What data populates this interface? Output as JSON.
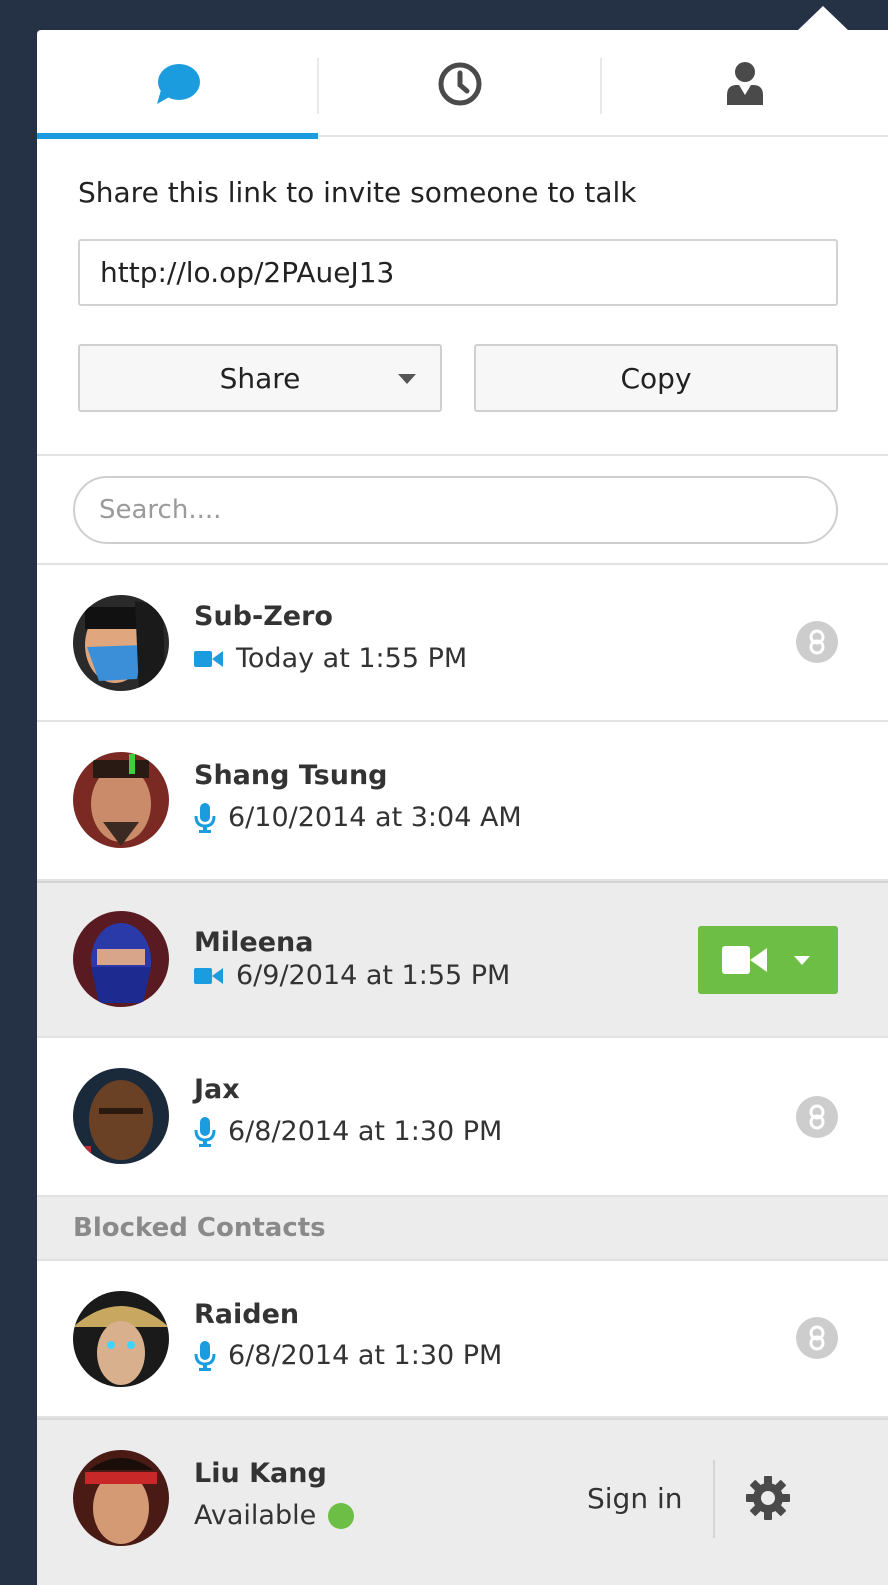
{
  "tabs": [
    {
      "name": "chat",
      "icon": "chat-bubble-icon",
      "active": true
    },
    {
      "name": "history",
      "icon": "clock-icon",
      "active": false
    },
    {
      "name": "contacts",
      "icon": "person-icon",
      "active": false
    }
  ],
  "invite": {
    "label": "Share this link to invite someone to talk",
    "link": "http://lo.op/2PAueJ13",
    "share_label": "Share",
    "copy_label": "Copy"
  },
  "search": {
    "placeholder": "Search...."
  },
  "contacts": [
    {
      "name": "Sub-Zero",
      "type": "video",
      "time": "Today at 1:55 PM"
    },
    {
      "name": "Shang Tsung",
      "type": "audio",
      "time": "6/10/2014 at 3:04 AM"
    },
    {
      "name": "Mileena",
      "type": "video",
      "time": "6/9/2014 at 1:55 PM"
    },
    {
      "name": "Jax",
      "type": "audio",
      "time": "6/8/2014 at 1:30 PM"
    }
  ],
  "blocked": {
    "header": "Blocked Contacts",
    "contacts": [
      {
        "name": "Raiden",
        "type": "audio",
        "time": "6/8/2014 at 1:30 PM"
      }
    ]
  },
  "user": {
    "name": "Liu Kang",
    "status": "Available",
    "sign_in_label": "Sign in"
  },
  "colors": {
    "accent": "#1b9cde",
    "call_green": "#6cbf44",
    "available": "#6cbf44",
    "background": "#253246"
  }
}
